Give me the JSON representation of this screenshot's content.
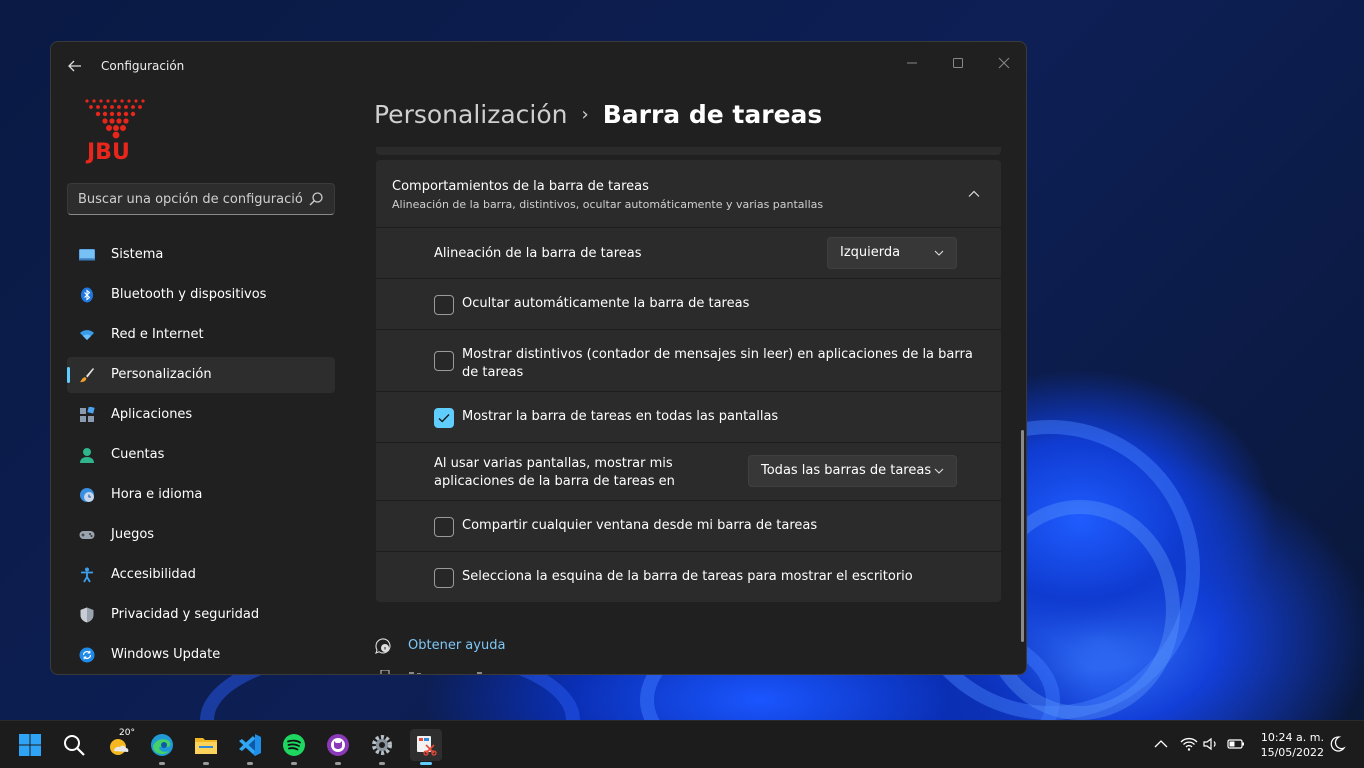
{
  "window": {
    "app_title": "Configuración",
    "controls": {
      "minimize": "—",
      "maximize": "☐",
      "close": "✕"
    }
  },
  "logo": {
    "text": "JBU",
    "color": "#e8261c"
  },
  "search": {
    "placeholder": "Buscar una opción de configuración"
  },
  "sidebar": {
    "items": [
      {
        "label": "Sistema",
        "icon": "monitor-icon"
      },
      {
        "label": "Bluetooth y dispositivos",
        "icon": "bluetooth-icon"
      },
      {
        "label": "Red e Internet",
        "icon": "wifi-icon"
      },
      {
        "label": "Personalización",
        "icon": "brush-icon",
        "active": true
      },
      {
        "label": "Aplicaciones",
        "icon": "apps-icon"
      },
      {
        "label": "Cuentas",
        "icon": "person-icon"
      },
      {
        "label": "Hora e idioma",
        "icon": "clock-globe-icon"
      },
      {
        "label": "Juegos",
        "icon": "gamepad-icon"
      },
      {
        "label": "Accesibilidad",
        "icon": "accessibility-icon"
      },
      {
        "label": "Privacidad y seguridad",
        "icon": "shield-icon"
      },
      {
        "label": "Windows Update",
        "icon": "update-icon"
      }
    ]
  },
  "breadcrumb": {
    "parent": "Personalización",
    "separator": "›",
    "current": "Barra de tareas"
  },
  "section": {
    "title": "Comportamientos de la barra de tareas",
    "subtitle": "Alineación de la barra, distintivos, ocultar automáticamente y varias pantallas",
    "alignment": {
      "label": "Alineación de la barra de tareas",
      "value": "Izquierda"
    },
    "autohide": {
      "label": "Ocultar automáticamente la barra de tareas",
      "checked": false
    },
    "badges": {
      "label_line1": "Mostrar distintivos (contador de mensajes sin leer) en aplicaciones de la barra",
      "label_line2": "de tareas",
      "checked": false
    },
    "all_displays": {
      "label": "Mostrar la barra de tareas en todas las pantallas",
      "checked": true
    },
    "multi_display": {
      "label_line1": "Al usar varias pantallas, mostrar mis",
      "label_line2": "aplicaciones de la barra de tareas en",
      "value": "Todas las barras de tareas"
    },
    "share_window": {
      "label": "Compartir cualquier ventana desde mi barra de tareas",
      "checked": false
    },
    "corner_desktop": {
      "label": "Selecciona la esquina de la barra de tareas para mostrar el escritorio",
      "checked": false
    }
  },
  "links": {
    "help": "Obtener ayuda"
  },
  "accent_color": "#60cdff",
  "taskbar": {
    "weather_temp": "20°",
    "apps": [
      "start-icon",
      "search-icon",
      "weather-icon",
      "edge-icon",
      "file-explorer-icon",
      "vscode-icon",
      "spotify-icon",
      "github-icon",
      "settings-icon",
      "snipping-tool-icon"
    ],
    "time": "10:24 a. m.",
    "date": "15/05/2022"
  }
}
